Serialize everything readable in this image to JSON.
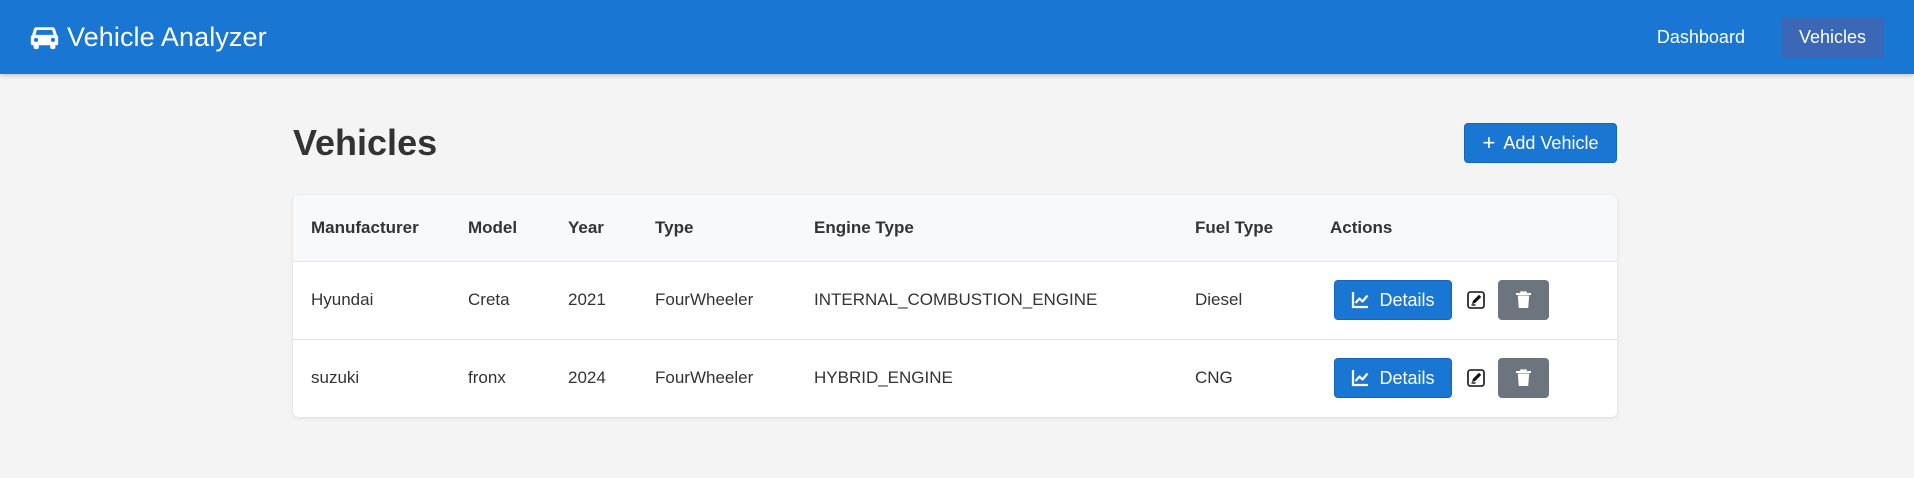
{
  "navbar": {
    "brand": "Vehicle Analyzer",
    "brand_icon": "car-icon",
    "links": [
      {
        "label": "Dashboard",
        "active": false
      },
      {
        "label": "Vehicles",
        "active": true
      }
    ],
    "color": "#1976d2"
  },
  "page": {
    "title": "Vehicles",
    "add_button": "Add Vehicle",
    "add_icon": "plus-icon"
  },
  "table": {
    "columns": [
      "Manufacturer",
      "Model",
      "Year",
      "Type",
      "Engine Type",
      "Fuel Type",
      "Actions"
    ],
    "rows": [
      {
        "manufacturer": "Hyundai",
        "model": "Creta",
        "year": "2021",
        "type": "FourWheeler",
        "engine_type": "INTERNAL_COMBUSTION_ENGINE",
        "fuel_type": "Diesel",
        "details_label": "Details"
      },
      {
        "manufacturer": "suzuki",
        "model": "fronx",
        "year": "2024",
        "type": "FourWheeler",
        "engine_type": "HYBRID_ENGINE",
        "fuel_type": "CNG",
        "details_label": "Details"
      }
    ],
    "icons": {
      "details": "chart-line-icon",
      "edit": "edit-icon",
      "delete": "trash-icon"
    }
  },
  "colors": {
    "primary": "#1976d2",
    "secondary": "#6c757d",
    "background": "#f4f4f4"
  }
}
